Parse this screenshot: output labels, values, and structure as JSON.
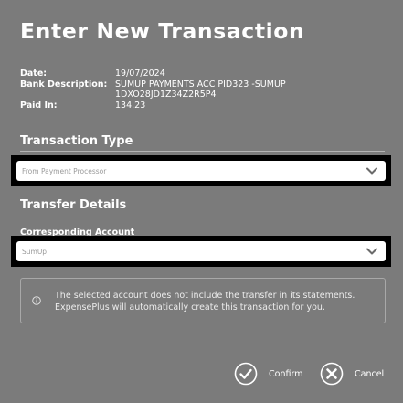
{
  "title": "Enter New Transaction",
  "details": {
    "date_label": "Date:",
    "date_value": "19/07/2024",
    "bank_description_label": "Bank Description:",
    "bank_description_value": "SUMUP PAYMENTS ACC PID323 -SUMUP 1DXO28JD1Z34Z2R5P4",
    "paid_in_label": "Paid In:",
    "paid_in_value": "134.23"
  },
  "transaction_type": {
    "section_title": "Transaction Type",
    "selected_value": "From Payment Processor"
  },
  "transfer_details": {
    "section_title": "Transfer Details",
    "corresponding_account_label": "Corresponding Account",
    "selected_value": "SumUp"
  },
  "info": {
    "icon": "info-icon",
    "message": "The selected account does not include the transfer in its statements. ExpensePlus will automatically create this transaction for you."
  },
  "actions": {
    "confirm_label": "Confirm",
    "confirm_icon": "check-circle-icon",
    "cancel_label": "Cancel",
    "cancel_icon": "close-circle-icon"
  },
  "colors": {
    "background": "#7b7b7b",
    "text": "#ffffff",
    "field_background": "#ffffff",
    "field_text": "#9a9a9a",
    "highlight_border": "#000000"
  }
}
